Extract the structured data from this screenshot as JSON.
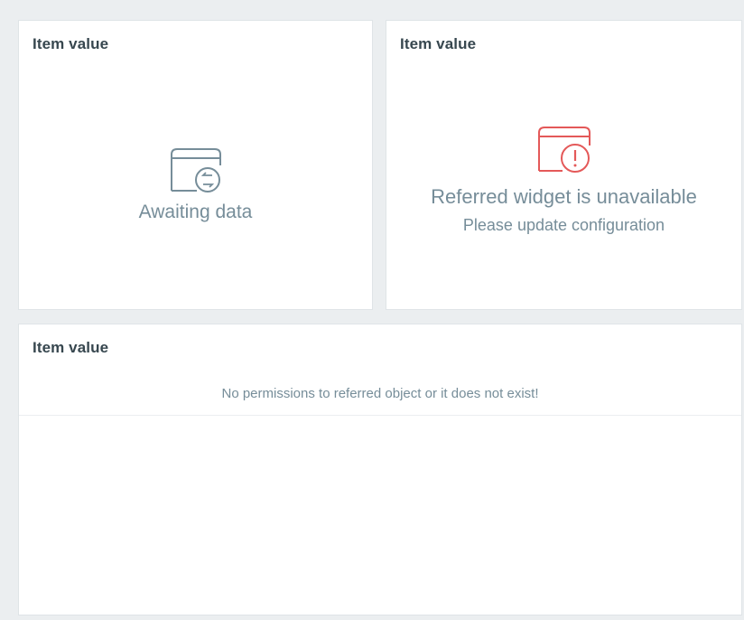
{
  "widgets": [
    {
      "title": "Item value",
      "state": "awaiting",
      "message": "Awaiting data",
      "icon": "awaiting-data-icon"
    },
    {
      "title": "Item value",
      "state": "unavailable",
      "message": "Referred widget is unavailable",
      "submessage": "Please update configuration",
      "icon": "warning-widget-icon"
    },
    {
      "title": "Item value",
      "state": "no-permissions",
      "message": "No permissions to referred object or it does not exist!"
    }
  ],
  "colors": {
    "background": "#ebeef0",
    "widget_bg": "#ffffff",
    "title": "#37474f",
    "muted_text": "#768d99",
    "warning": "#e45959"
  }
}
